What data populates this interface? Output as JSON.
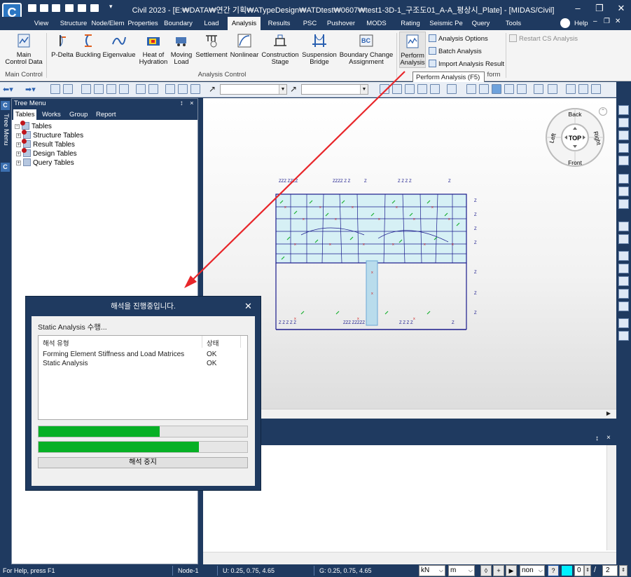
{
  "app": {
    "title": "Civil 2023 - [E:₩DATA₩연간 기획₩ATypeDesign₩ATDtest₩0607₩test1-3D-1_구조도01_A-A_평상시_Plate] - [MIDAS/Civil]",
    "logo": "C"
  },
  "menu_tabs": [
    "View",
    "Structure",
    "Node/Elem",
    "Properties",
    "Boundary",
    "Load",
    "Analysis",
    "Results",
    "PSC",
    "Pushover",
    "MODS",
    "Rating",
    "Seismic Pe",
    "Query",
    "Tools"
  ],
  "active_tab": "Analysis",
  "help_label": "Help",
  "ribbon": {
    "main_control": {
      "label": "Main\nControl Data",
      "group": "Main Control"
    },
    "analysis_buttons": [
      "P-Delta",
      "Buckling",
      "Eigenvalue",
      "Heat of\nHydration",
      "Moving\nLoad",
      "Settlement",
      "Nonlinear",
      "Construction\nStage",
      "Suspension\nBridge",
      "Boundary Change\nAssignment"
    ],
    "analysis_group": "Analysis Control",
    "perform": {
      "label": "Perform\nAnalysis",
      "group_suffix": "form"
    },
    "small_buttons": [
      "Analysis Options",
      "Batch Analysis",
      "Import Analysis Result"
    ],
    "restart": "Restart CS Analysis"
  },
  "tooltip": "Perform Analysis (F5)",
  "tree": {
    "header": "Tree Menu",
    "side_label": "Tree Menu",
    "tabs": [
      "Tables",
      "Works",
      "Group",
      "Report"
    ],
    "root": "Tables",
    "items": [
      "Structure Tables",
      "Result Tables",
      "Design Tables",
      "Query Tables"
    ]
  },
  "view_cube": {
    "back": "Back",
    "front": "Front",
    "left": "Left",
    "right": "Right",
    "top": "TOP"
  },
  "dialog": {
    "title": "해석을 진행중입니다.",
    "status": "Static Analysis 수행...",
    "col_type": "해석 유형",
    "col_state": "상태",
    "rows": [
      {
        "type": "Forming Element Stiffness and Load Matrices",
        "state": "OK"
      },
      {
        "type": "Static Analysis",
        "state": "OK"
      }
    ],
    "progress1": 0.58,
    "progress2": 0.77,
    "stop_label": "해석 중지"
  },
  "status_bar": {
    "help": "For Help, press F1",
    "node": "Node-1",
    "u": "U: 0.25, 0.75, 4.65",
    "g": "G: 0.25, 0.75, 4.65",
    "force_unit": "kN",
    "length_unit": "m",
    "display": "non",
    "help_btn": "?",
    "num1": "0",
    "slash": "/",
    "num2": "2"
  },
  "colors": {
    "frame": "#1f3a60",
    "ribbon": "#f4f4f4",
    "progress": "#06b025",
    "model_fill": "#d6f0f5",
    "arrow": "#e8262a"
  }
}
